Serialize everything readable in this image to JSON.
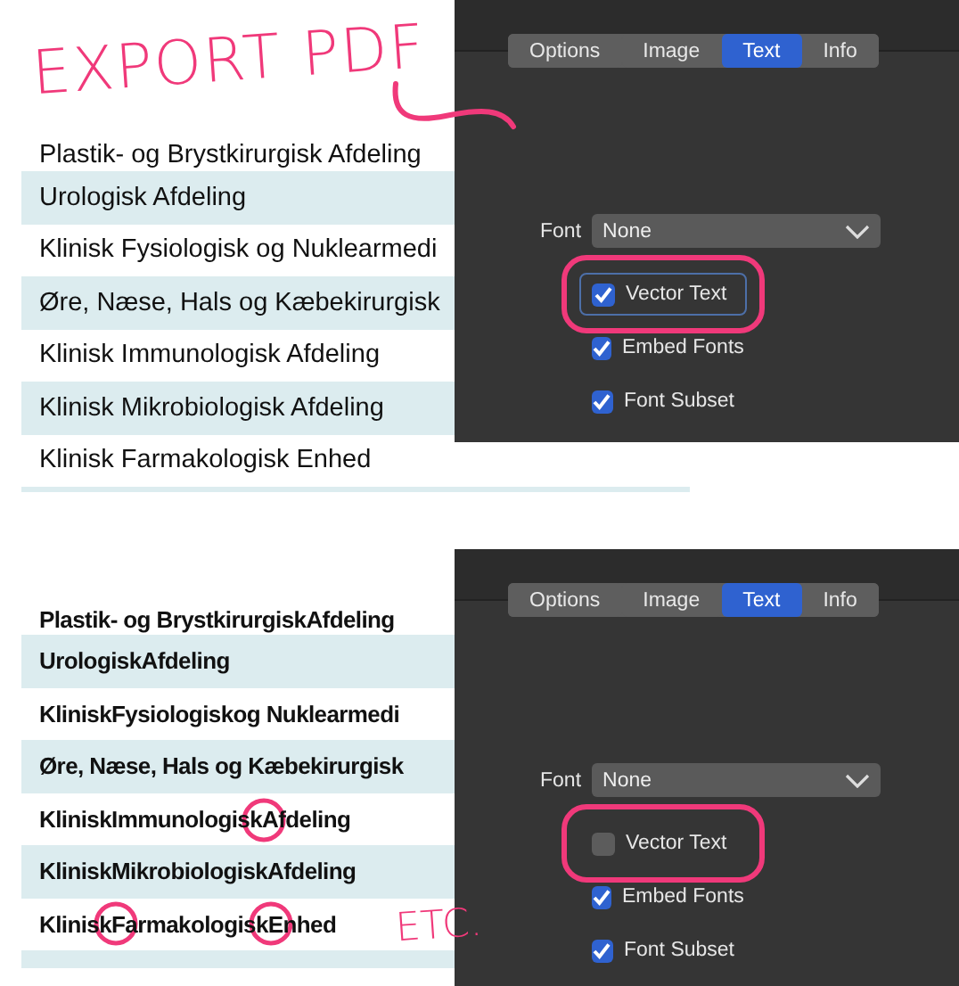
{
  "panels": [
    {
      "annotation": {
        "text": "EXPORT PDF"
      },
      "kind": "regular",
      "rows": [
        {
          "label": "Plastik- og Brystkirurgisk Afdeling",
          "shaded": false,
          "clipped": true
        },
        {
          "label": "Urologisk Afdeling",
          "shaded": true,
          "clipped": false
        },
        {
          "label": "Klinisk Fysiologisk og Nuklearmedi",
          "shaded": false,
          "clipped": false
        },
        {
          "label": "Øre, Næse, Hals og Kæbekirurgisk",
          "shaded": true,
          "clipped": false
        },
        {
          "label": "Klinisk Immunologisk Afdeling",
          "shaded": false,
          "clipped": false
        },
        {
          "label": "Klinisk Mikrobiologisk Afdeling",
          "shaded": true,
          "clipped": false
        },
        {
          "label": "Klinisk Farmakologisk Enhed",
          "shaded": false,
          "clipped": false
        }
      ],
      "dialog": {
        "tabs": [
          {
            "label": "Options",
            "selected": false
          },
          {
            "label": "Image",
            "selected": false
          },
          {
            "label": "Text",
            "selected": true
          },
          {
            "label": "Info",
            "selected": false
          }
        ],
        "font_label": "Font",
        "font_value": "None",
        "checkboxes": [
          {
            "label": "Vector Text",
            "checked": true,
            "focused": true,
            "highlighted": true
          },
          {
            "label": "Embed Fonts",
            "checked": true,
            "focused": false,
            "highlighted": false
          },
          {
            "label": "Font Subset",
            "checked": true,
            "focused": false,
            "highlighted": false
          }
        ]
      }
    },
    {
      "annotation": {
        "note": "ETC.",
        "circled_letters": true
      },
      "kind": "bold",
      "rows": [
        {
          "label": "Plastik- og BrystkirurgiskAfdeling",
          "shaded": false,
          "clipped": true
        },
        {
          "label": "UrologiskAfdeling",
          "shaded": true,
          "clipped": false
        },
        {
          "label": "KliniskFysiologiskog Nuklearmedi",
          "shaded": false,
          "clipped": false
        },
        {
          "label": "Øre, Næse, Hals og Kæbekirurgisk",
          "shaded": true,
          "clipped": false
        },
        {
          "label": "KliniskImmunologiskAfdeling",
          "shaded": false,
          "clipped": false
        },
        {
          "label": "KliniskMikrobiologiskAfdeling",
          "shaded": true,
          "clipped": false
        },
        {
          "label": "KliniskFarmakologiskEnhed",
          "shaded": false,
          "clipped": false
        }
      ],
      "dialog": {
        "tabs": [
          {
            "label": "Options",
            "selected": false
          },
          {
            "label": "Image",
            "selected": false
          },
          {
            "label": "Text",
            "selected": true
          },
          {
            "label": "Info",
            "selected": false
          }
        ],
        "font_label": "Font",
        "font_value": "None",
        "checkboxes": [
          {
            "label": "Vector Text",
            "checked": false,
            "focused": false,
            "highlighted": true
          },
          {
            "label": "Embed Fonts",
            "checked": true,
            "focused": false,
            "highlighted": false
          },
          {
            "label": "Font Subset",
            "checked": true,
            "focused": false,
            "highlighted": false
          }
        ]
      }
    }
  ]
}
